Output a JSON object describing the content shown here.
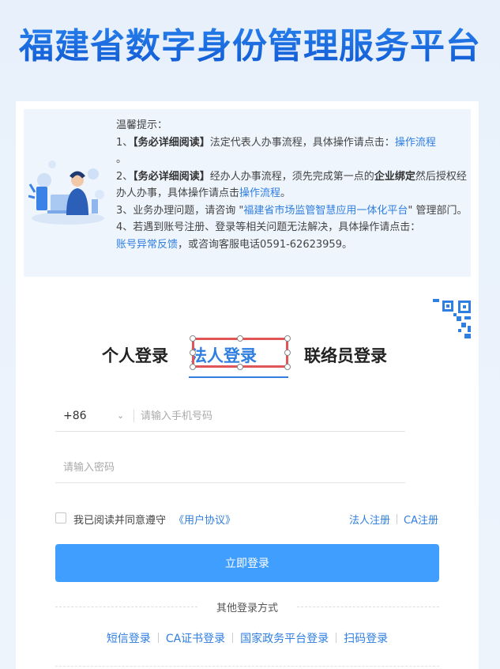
{
  "site": {
    "title": "福建省数字身份管理服务平台"
  },
  "notice": {
    "heading": "温馨提示：",
    "item1_prefix": "1、",
    "item1_bold": "【务必详细阅读】",
    "item1_text": "法定代表人办事流程，具体操作请点击：",
    "item1_link": "操作流程",
    "item1_end": "。",
    "item2_prefix": "2、",
    "item2_bold": "【务必详细阅读】",
    "item2_text_a": "经办人办事流程，须先完成第一点的",
    "item2_bold2": "企业绑定",
    "item2_text_b": "然后授权经办人办事，具体操作请点击",
    "item2_link": "操作流程",
    "item2_end": "。",
    "item3_text_a": "3、业务办理问题，请咨询 \"",
    "item3_link": "福建省市场监管智慧应用一体化平台",
    "item3_text_b": "\" 管理部门。",
    "item4_text": "4、若遇到账号注册、登录等相关问题无法解决，具体操作请点击：",
    "item4_link": "账号异常反馈",
    "item4_text_b": "，或咨询客服电话0591-62623959。"
  },
  "tabs": {
    "personal": "个人登录",
    "legal": "法人登录",
    "contact": "联络员登录",
    "active": "法人登录"
  },
  "form": {
    "country_code": "+86",
    "phone_placeholder": "请输入手机号码",
    "password_placeholder": "请输入密码",
    "agree_text": "我已阅读并同意遵守",
    "agreement_link": "《用户协议》",
    "register_legal": "法人注册",
    "register_ca": "CA注册",
    "login_button": "立即登录"
  },
  "other": {
    "title": "其他登录方式",
    "methods": [
      "短信登录",
      "CA证书登录",
      "国家政务平台登录",
      "扫码登录"
    ]
  },
  "colors": {
    "accent": "#2f7ee0",
    "button": "#409eff",
    "title": "#1a6fe0",
    "selection": "#e05656"
  }
}
